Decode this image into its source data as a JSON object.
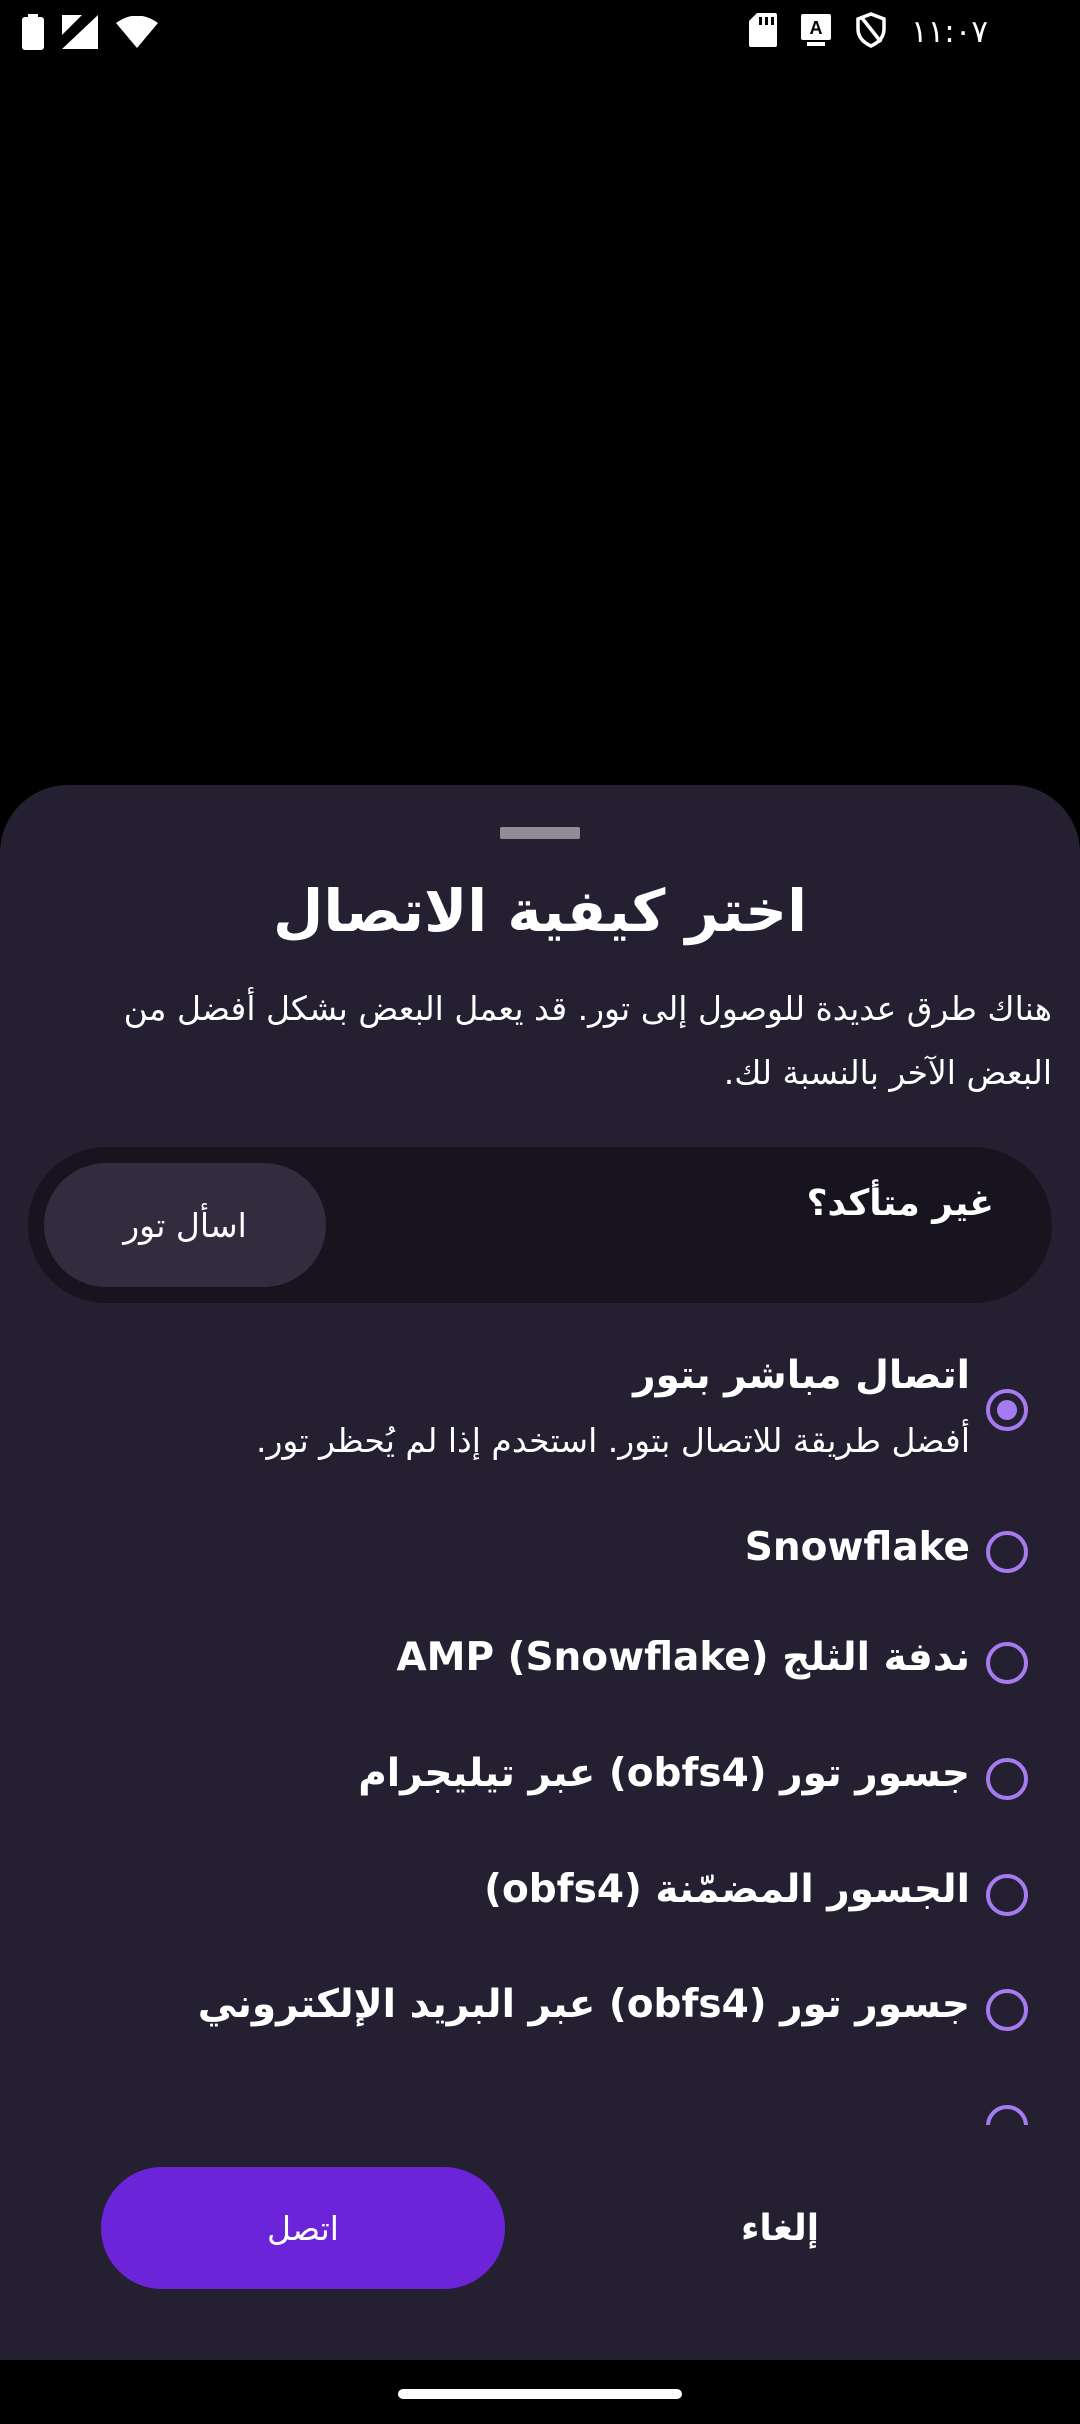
{
  "status_bar": {
    "time": "١١:٠٧",
    "left_icons": [
      "battery-icon",
      "cellular-signal-icon",
      "wifi-icon"
    ],
    "right_icons": [
      "sd-card-icon",
      "keyboard-a-icon",
      "vpn-shield-icon"
    ]
  },
  "sheet": {
    "title": "اختر كيفية الاتصال",
    "description": "هناك طرق عديدة للوصول إلى تور. قد يعمل البعض بشكل أفضل من البعض الآخر بالنسبة لك.",
    "unsure": {
      "label": "غير متأكد؟",
      "ask_button": "اسأل تور"
    },
    "options": [
      {
        "title": "اتصال مباشر بتور",
        "subtitle": "أفضل طريقة للاتصال بتور. استخدم إذا لم يُحظر تور.",
        "selected": true
      },
      {
        "title": "Snowflake",
        "selected": false
      },
      {
        "title": "ندفة الثلج (Snowflake) AMP",
        "selected": false
      },
      {
        "title": "جسور تور (obfs4) عبر تيليجرام",
        "selected": false
      },
      {
        "title": "الجسور المضمّنة (obfs4)",
        "selected": false
      },
      {
        "title": "جسور تور (obfs4) عبر البريد الإلكتروني",
        "selected": false
      }
    ],
    "connect_button": "اتصل",
    "cancel_button": "إلغاء"
  },
  "colors": {
    "accent": "#a77bf0",
    "primary_button": "#6c24d8",
    "sheet_background": "#252031"
  }
}
